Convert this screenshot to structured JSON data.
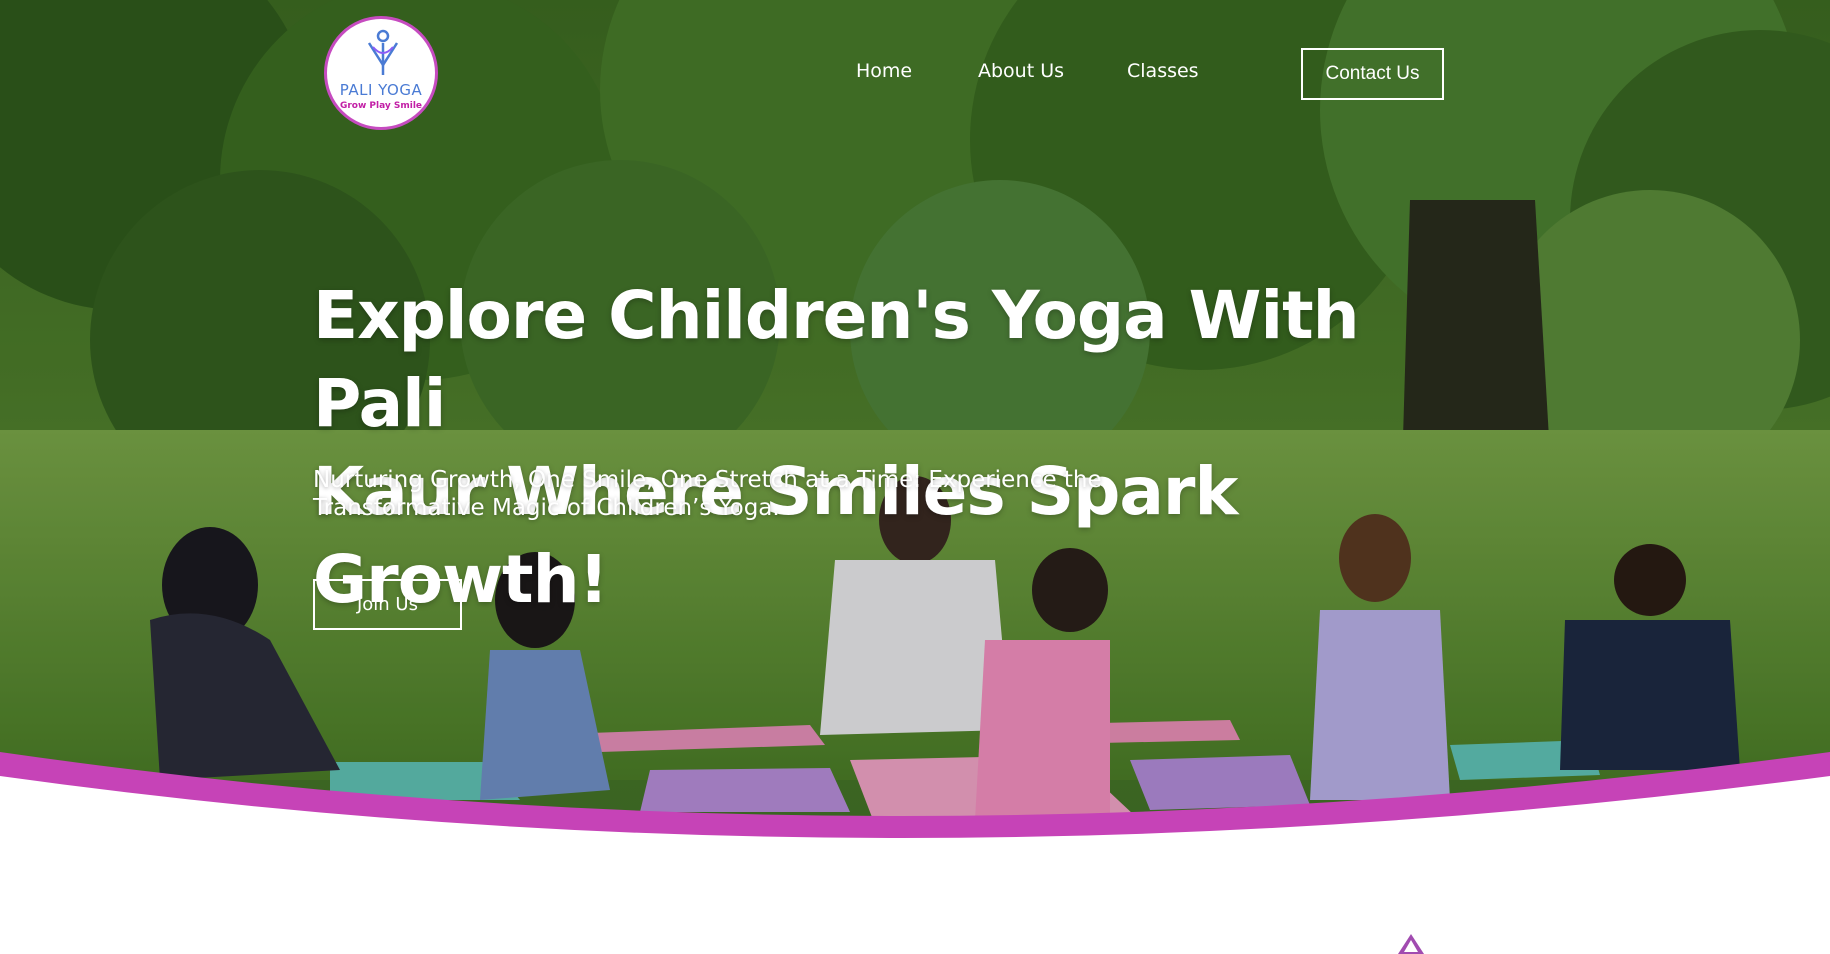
{
  "colors": {
    "accent": "#c64bc0",
    "wave": "#c643b7",
    "text_on_hero": "#ffffff",
    "logo_blue": "#4a7bd4",
    "logo_pink": "#c21fa6"
  },
  "logo": {
    "icon": "yoga-figure-icon",
    "name": "PALI YOGA",
    "tagline": "Grow Play Smile"
  },
  "nav": {
    "items": [
      {
        "label": "Home"
      },
      {
        "label": "About Us"
      },
      {
        "label": "Classes"
      }
    ],
    "contact_label": "Contact Us"
  },
  "hero": {
    "heading_line1": "Explore Children's Yoga With Pali",
    "heading_line2": "Kaur Where Smiles Spark Growth!",
    "subheading_line1": "Nurturing Growth, One Smile, One Stretch at a Time: Experience the",
    "subheading_line2": "Transformative Magic of Children’s Yoga.",
    "cta_label": "Join Us",
    "background": "outdoor-kids-yoga-class-photo"
  },
  "below_fold": {
    "icon": "decorative-ornament-icon"
  }
}
